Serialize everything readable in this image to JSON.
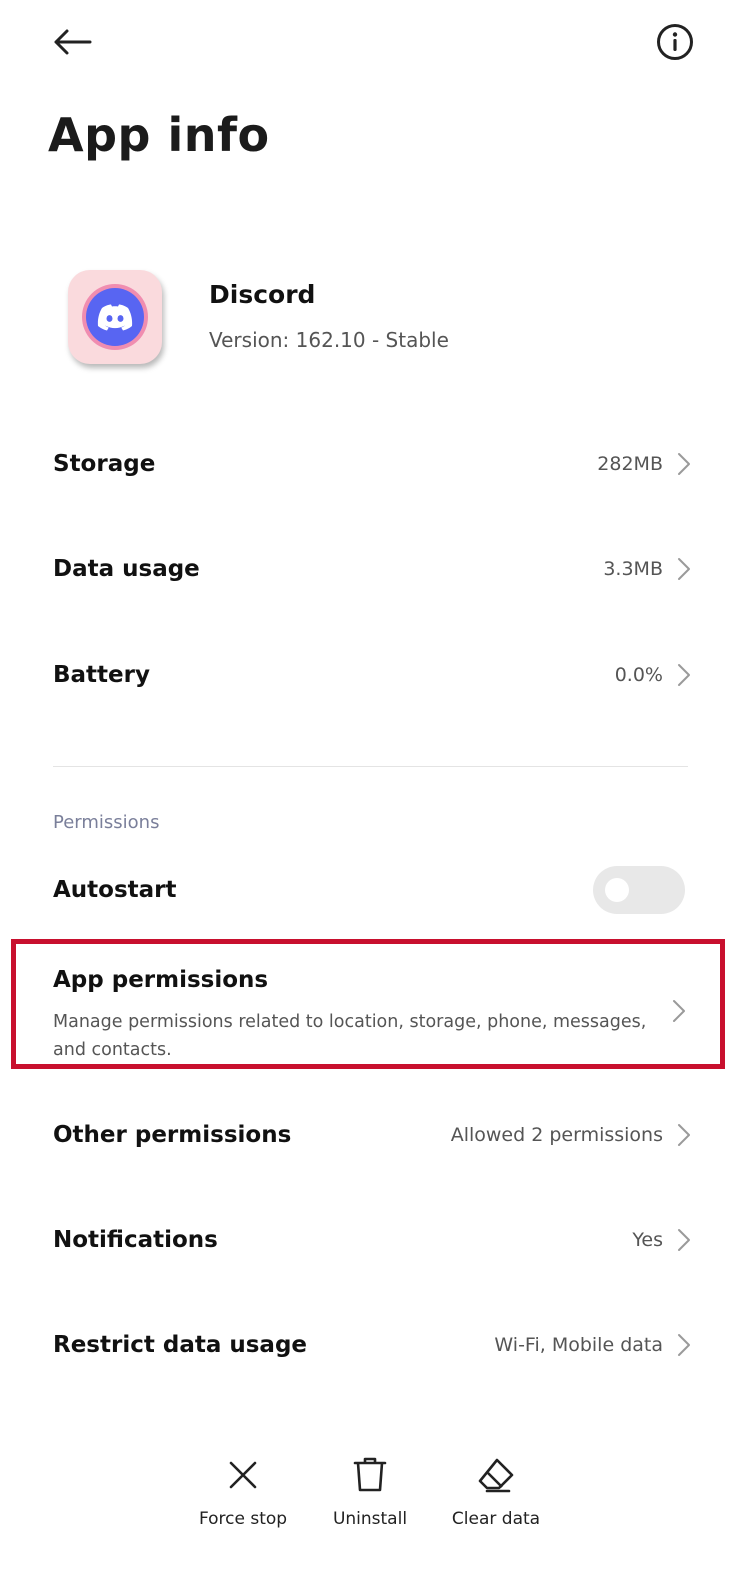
{
  "header": {
    "title": "App info",
    "back_icon": "arrow-left-icon",
    "info_icon": "info-circle-icon"
  },
  "app": {
    "name": "Discord",
    "version": "Version: 162.10 - Stable",
    "icon": "discord-logo-icon",
    "colors": {
      "icon_bg": "#fadadd",
      "icon_ring": "#f08db0",
      "icon_core": "#5865f2"
    }
  },
  "rows": {
    "storage": {
      "label": "Storage",
      "value": "282MB"
    },
    "data_usage": {
      "label": "Data usage",
      "value": "3.3MB"
    },
    "battery": {
      "label": "Battery",
      "value": "0.0%"
    }
  },
  "permissions": {
    "section_header": "Permissions",
    "autostart": {
      "label": "Autostart",
      "enabled": false
    },
    "app_permissions": {
      "label": "App permissions",
      "description": "Manage permissions related to location, storage, phone, messages, and contacts."
    },
    "other_permissions": {
      "label": "Other permissions",
      "value": "Allowed 2 permissions"
    },
    "notifications": {
      "label": "Notifications",
      "value": "Yes"
    },
    "restrict_data_usage": {
      "label": "Restrict data usage",
      "value": "Wi-Fi, Mobile data"
    }
  },
  "actions": {
    "force_stop": {
      "label": "Force stop",
      "icon": "close-x-icon"
    },
    "uninstall": {
      "label": "Uninstall",
      "icon": "trash-icon"
    },
    "clear_data": {
      "label": "Clear data",
      "icon": "eraser-icon"
    }
  },
  "highlight_color": "#c8102e"
}
